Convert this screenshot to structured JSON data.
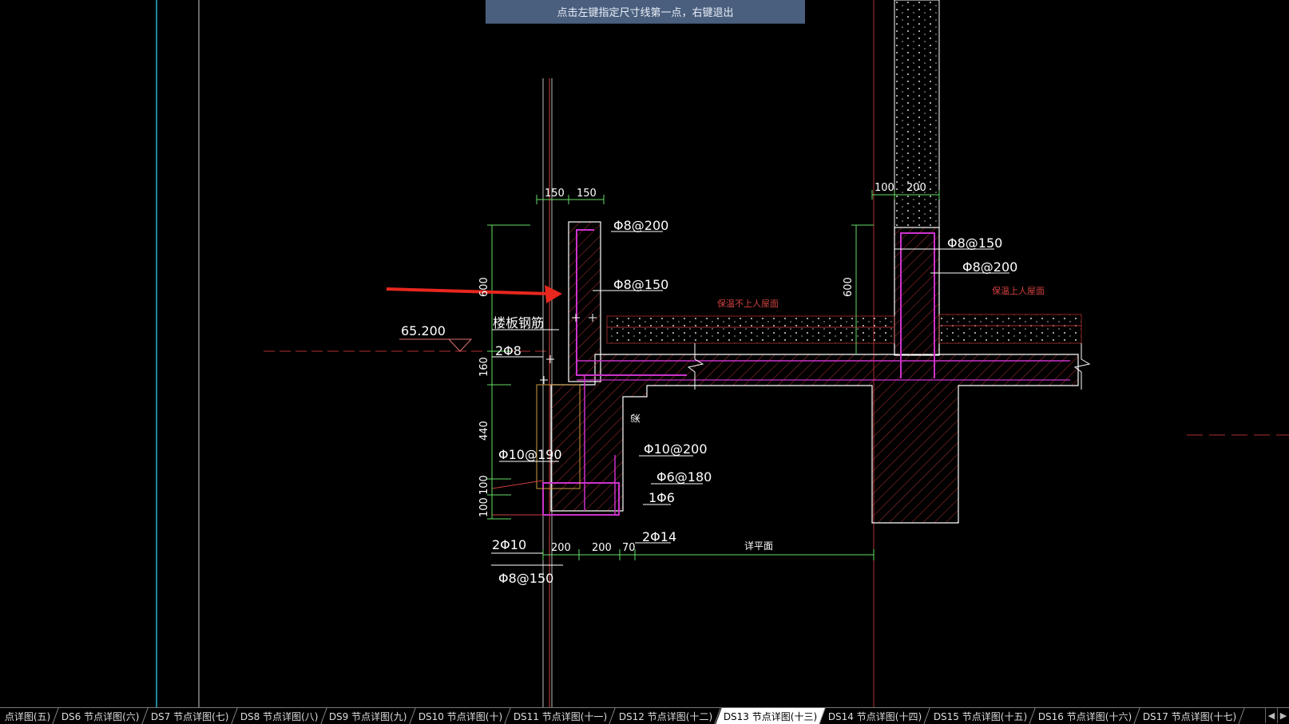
{
  "prompt": "点击左键指定尺寸线第一点，右键退出",
  "drawing": {
    "dims": {
      "top_left_1": "150",
      "top_left_2": "150",
      "top_right_1": "100",
      "top_right_2": "200",
      "vert_600_left": "600",
      "vert_600_right": "600",
      "vert_160": "160",
      "vert_440": "440",
      "vert_100_a": "100",
      "vert_100_b": "100",
      "bottom_200_a": "200",
      "bottom_200_b": "200",
      "bottom_70": "70"
    },
    "labels": {
      "rebar_p8_200_a": "Φ8@200",
      "rebar_p8_150_a": "Φ8@150",
      "rebar_p8_150_b": "Φ8@150",
      "rebar_p8_200_b": "Φ8@200",
      "slab_rebar": "楼板钢筋",
      "rebar_2p8": "2Φ8",
      "elevation": "65.200",
      "rebar_p10_190": "Φ10@190",
      "rebar_p10_200": "Φ10@200",
      "rebar_p6_180": "Φ6@180",
      "rebar_1p6": "1Φ6",
      "rebar_2p10": "2Φ10",
      "rebar_2p14": "2Φ14",
      "rebar_p8_150_c": "Φ8@150",
      "beam_mark": "梁",
      "roof_note_left": "保温不上人屋面",
      "roof_note_right": "保温上人屋面",
      "detail_note": "详平面"
    }
  },
  "tabs": [
    {
      "label": "点详图(五)",
      "active": false
    },
    {
      "label": "DS6 节点详图(六)",
      "active": false
    },
    {
      "label": "DS7 节点详图(七)",
      "active": false
    },
    {
      "label": "DS8 节点详图(八)",
      "active": false
    },
    {
      "label": "DS9 节点详图(九)",
      "active": false
    },
    {
      "label": "DS10 节点详图(十)",
      "active": false
    },
    {
      "label": "DS11 节点详图(十一)",
      "active": false
    },
    {
      "label": "DS12 节点详图(十二)",
      "active": false
    },
    {
      "label": "DS13 节点详图(十三)",
      "active": true
    },
    {
      "label": "DS14 节点详图(十四)",
      "active": false
    },
    {
      "label": "DS15 节点详图(十五)",
      "active": false
    },
    {
      "label": "DS16 节点详图(十六)",
      "active": false
    },
    {
      "label": "DS17 节点详图(十七)",
      "active": false
    }
  ],
  "nav": {
    "prev": "◀",
    "next": "▶"
  },
  "colors": {
    "background": "#000000",
    "concrete_outline": "#ffffff",
    "rebar": "#cc33cc",
    "dimension": "#66dd66",
    "text": "#ffffff",
    "arrow": "#e8271e",
    "grid_line": "#29b6c9",
    "note_red": "#d04040",
    "hatch": "#b03030"
  }
}
